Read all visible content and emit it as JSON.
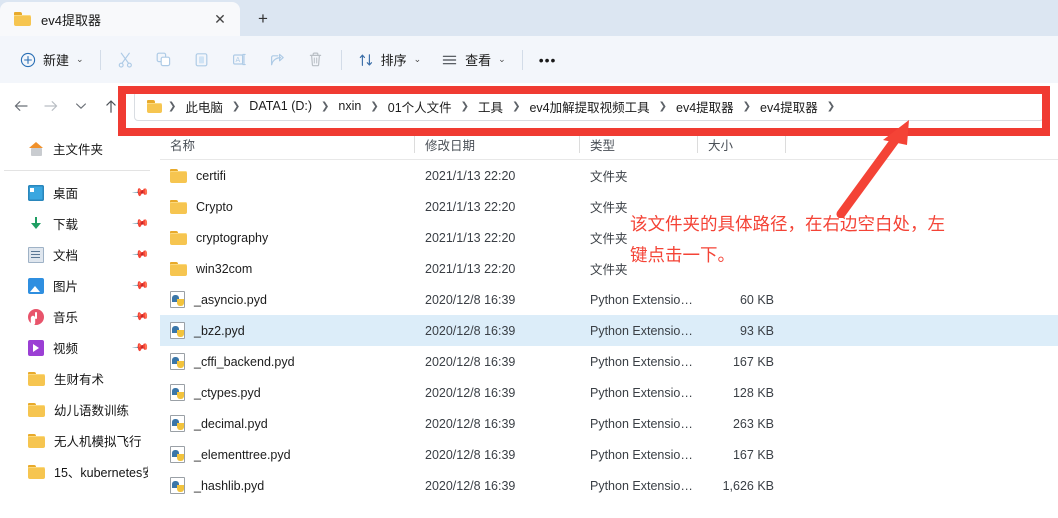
{
  "window": {
    "tab": {
      "title": "ev4提取器",
      "close_label": "✕",
      "icon": "folder-icon"
    },
    "new_tab_label": "+"
  },
  "toolbar": {
    "new_label": "新建",
    "new_icon": "plus-circle-icon",
    "cut_icon": "scissors-icon",
    "copy_icon": "copy-icon",
    "paste_icon": "clipboard-icon",
    "rename_icon": "rename-icon",
    "share_icon": "share-icon",
    "delete_icon": "trash-icon",
    "sort_label": "排序",
    "sort_icon": "sort-arrows-icon",
    "view_label": "查看",
    "view_icon": "list-lines-icon",
    "more_label": "•••",
    "caret": "⌄"
  },
  "navigation": {
    "back_icon": "arrow-left-icon",
    "forward_icon": "arrow-right-icon",
    "recent_icon": "chevron-down-icon",
    "up_icon": "arrow-up-icon"
  },
  "address": {
    "folder_icon": "folder-icon",
    "separator": "❯",
    "crumbs": [
      "此电脑",
      "DATA1 (D:)",
      "nxin",
      "01个人文件",
      "工具",
      "ev4加解提取视频工具",
      "ev4提取器",
      "ev4提取器"
    ]
  },
  "sidebar": {
    "home": {
      "label": "主文件夹",
      "icon": "home-icon"
    },
    "items": [
      {
        "label": "桌面",
        "icon": "desktop-icon",
        "pinned": true
      },
      {
        "label": "下载",
        "icon": "download-icon",
        "pinned": true
      },
      {
        "label": "文档",
        "icon": "document-icon",
        "pinned": true
      },
      {
        "label": "图片",
        "icon": "picture-icon",
        "pinned": true
      },
      {
        "label": "音乐",
        "icon": "music-icon",
        "pinned": true
      },
      {
        "label": "视频",
        "icon": "video-icon",
        "pinned": true
      },
      {
        "label": "生财有术",
        "icon": "folder-icon",
        "pinned": false
      },
      {
        "label": "幼儿语数训练",
        "icon": "folder-icon",
        "pinned": false
      },
      {
        "label": "无人机模拟飞行",
        "icon": "folder-icon",
        "pinned": false
      },
      {
        "label": "15、kubernetes安",
        "icon": "folder-icon",
        "pinned": false
      }
    ],
    "pin_glyph": "📌"
  },
  "filelist": {
    "columns": {
      "name": "名称",
      "date": "修改日期",
      "type": "类型",
      "size": "大小"
    },
    "rows": [
      {
        "name": "certifi",
        "icon": "folder-icon",
        "date": "2021/1/13 22:20",
        "type": "文件夹",
        "size": "",
        "selected": false
      },
      {
        "name": "Crypto",
        "icon": "folder-icon",
        "date": "2021/1/13 22:20",
        "type": "文件夹",
        "size": "",
        "selected": false
      },
      {
        "name": "cryptography",
        "icon": "folder-icon",
        "date": "2021/1/13 22:20",
        "type": "文件夹",
        "size": "",
        "selected": false
      },
      {
        "name": "win32com",
        "icon": "folder-icon",
        "date": "2021/1/13 22:20",
        "type": "文件夹",
        "size": "",
        "selected": false
      },
      {
        "name": "_asyncio.pyd",
        "icon": "python-file-icon",
        "date": "2020/12/8 16:39",
        "type": "Python Extensio…",
        "size": "60 KB",
        "selected": false
      },
      {
        "name": "_bz2.pyd",
        "icon": "python-file-icon",
        "date": "2020/12/8 16:39",
        "type": "Python Extensio…",
        "size": "93 KB",
        "selected": true
      },
      {
        "name": "_cffi_backend.pyd",
        "icon": "python-file-icon",
        "date": "2020/12/8 16:39",
        "type": "Python Extensio…",
        "size": "167 KB",
        "selected": false
      },
      {
        "name": "_ctypes.pyd",
        "icon": "python-file-icon",
        "date": "2020/12/8 16:39",
        "type": "Python Extensio…",
        "size": "128 KB",
        "selected": false
      },
      {
        "name": "_decimal.pyd",
        "icon": "python-file-icon",
        "date": "2020/12/8 16:39",
        "type": "Python Extensio…",
        "size": "263 KB",
        "selected": false
      },
      {
        "name": "_elementtree.pyd",
        "icon": "python-file-icon",
        "date": "2020/12/8 16:39",
        "type": "Python Extensio…",
        "size": "167 KB",
        "selected": false
      },
      {
        "name": "_hashlib.pyd",
        "icon": "python-file-icon",
        "date": "2020/12/8 16:39",
        "type": "Python Extensio…",
        "size": "1,626 KB",
        "selected": false
      }
    ]
  },
  "annotation": {
    "note_text": "该文件夹的具体路径，在右边空白处，左\n键点击一下。",
    "color": "#f44336",
    "box_color": "#f03b32"
  }
}
